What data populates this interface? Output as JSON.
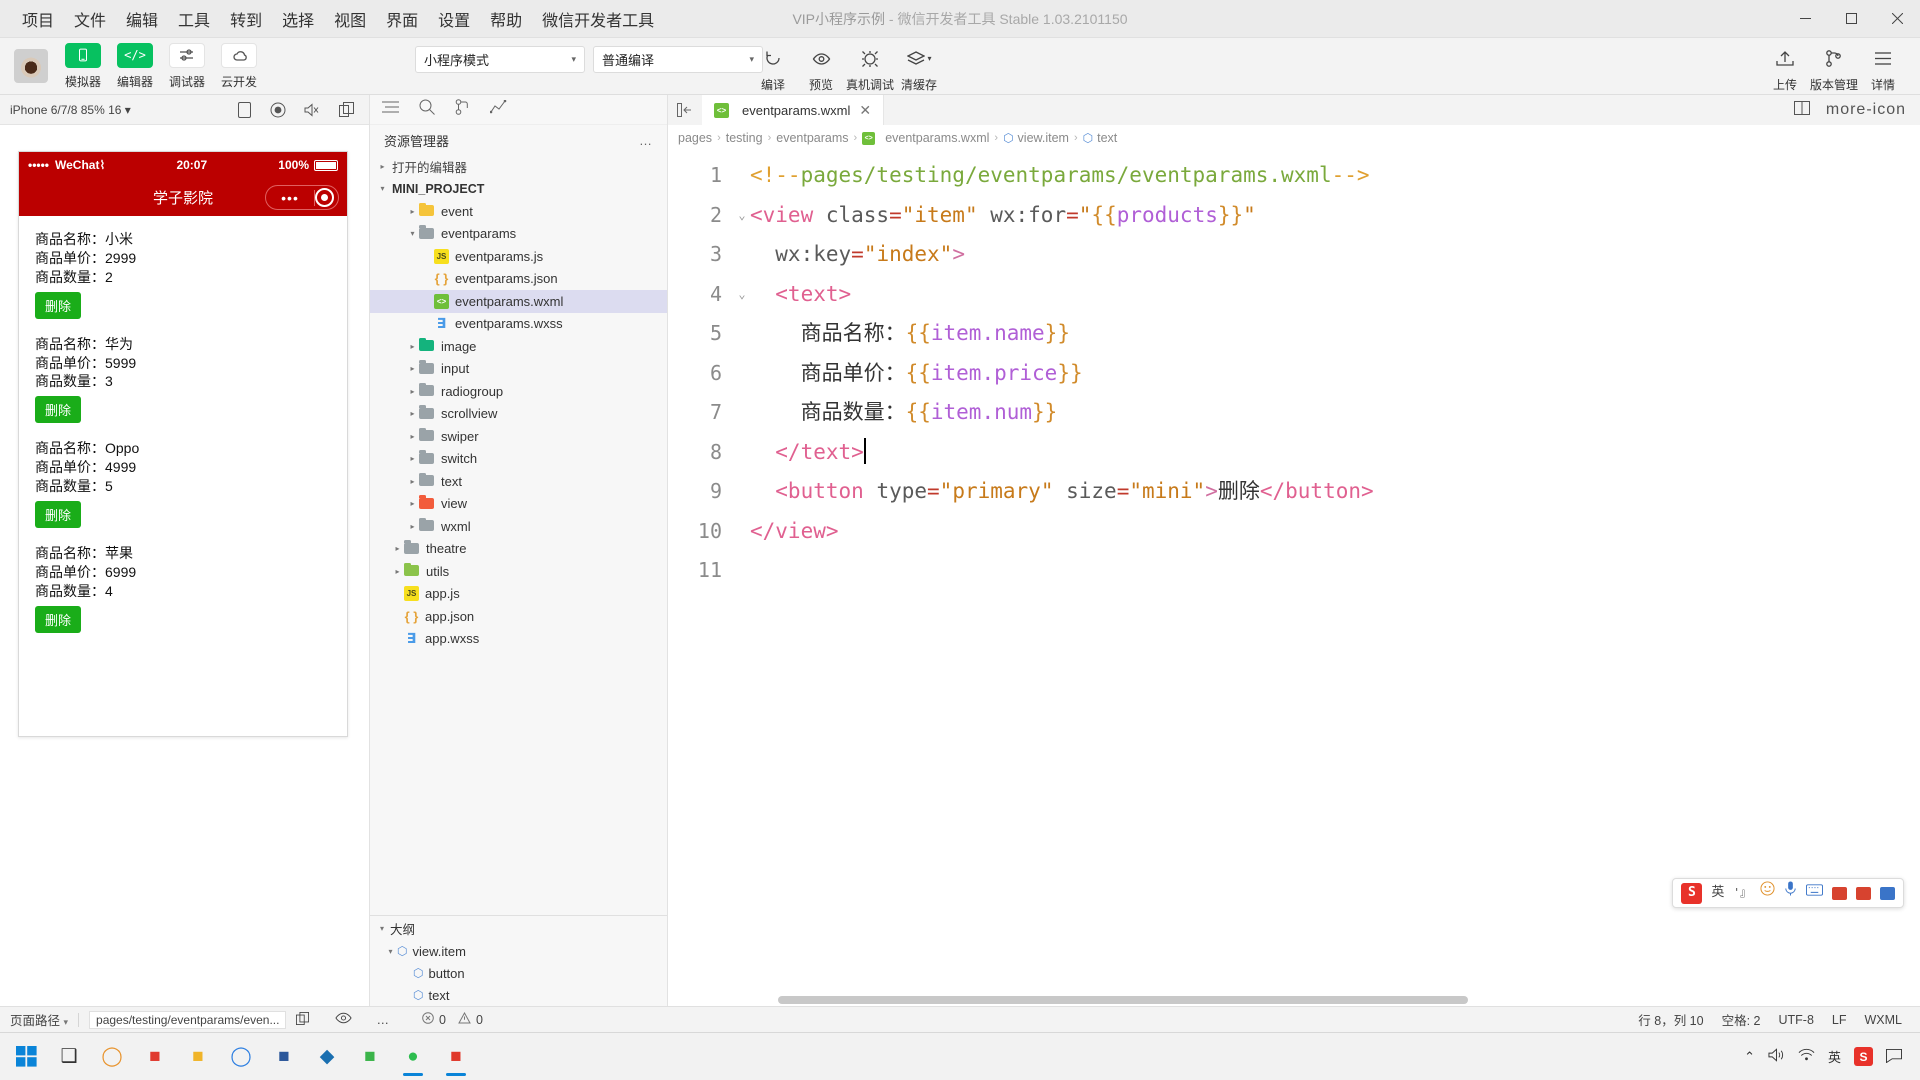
{
  "titlebar": {
    "menu": [
      "项目",
      "文件",
      "编辑",
      "工具",
      "转到",
      "选择",
      "视图",
      "界面",
      "设置",
      "帮助",
      "微信开发者工具"
    ],
    "title_primary": "VIP小程序示例",
    "title_rest": "- 微信开发者工具 Stable 1.03.2101150",
    "minimize": "─",
    "maximize": "☐",
    "close": "✕"
  },
  "toolbar": {
    "left_buttons": [
      {
        "label": "模拟器",
        "icon": "phone-icon",
        "active": true
      },
      {
        "label": "编辑器",
        "icon": "code-icon",
        "active": true
      },
      {
        "label": "调试器",
        "icon": "sliders-icon",
        "active": false
      },
      {
        "label": "云开发",
        "icon": "cloud-icon",
        "active": false
      }
    ],
    "mode_select": {
      "value": "小程序模式",
      "caret": "▾"
    },
    "compile_select": {
      "value": "普通编译",
      "caret": "▾"
    },
    "center_buttons": [
      {
        "label": "编译",
        "icon": "refresh-icon"
      },
      {
        "label": "预览",
        "icon": "eye-icon"
      },
      {
        "label": "真机调试",
        "icon": "device-debug-icon"
      },
      {
        "label": "清缓存",
        "icon": "layers-icon",
        "caret": "▾"
      }
    ],
    "right_buttons": [
      {
        "label": "上传",
        "icon": "upload-icon"
      },
      {
        "label": "版本管理",
        "icon": "branch-icon"
      },
      {
        "label": "详情",
        "icon": "menu-icon"
      }
    ]
  },
  "simulator": {
    "device_label": "iPhone 6/7/8 85% 16",
    "device_caret": "▾",
    "toolbar_icons": [
      "rotate-icon",
      "record-icon",
      "mute-icon",
      "copy-icon"
    ],
    "status": {
      "signal": "•••••",
      "carrier": "WeChat",
      "wifi": "⌇",
      "time": "20:07",
      "battery": "100%"
    },
    "nav_title": "学子影院",
    "capsule_dots": "•••",
    "products": [
      {
        "name_label": "商品名称：",
        "name": "小米",
        "price_label": "商品单价：",
        "price": "2999",
        "num_label": "商品数量：",
        "num": "2",
        "button": "删除"
      },
      {
        "name_label": "商品名称：",
        "name": "华为",
        "price_label": "商品单价：",
        "price": "5999",
        "num_label": "商品数量：",
        "num": "3",
        "button": "删除"
      },
      {
        "name_label": "商品名称：",
        "name": "Oppo",
        "price_label": "商品单价：",
        "price": "4999",
        "num_label": "商品数量：",
        "num": "5",
        "button": "删除"
      },
      {
        "name_label": "商品名称：",
        "name": "苹果",
        "price_label": "商品单价：",
        "price": "6999",
        "num_label": "商品数量：",
        "num": "4",
        "button": "删除"
      }
    ]
  },
  "explorer": {
    "tools": [
      "list-icon",
      "search-icon",
      "source-control-icon",
      "graph-icon"
    ],
    "header": "资源管理器",
    "header_dots": "…",
    "sections": [
      {
        "label": "打开的编辑器",
        "expanded": false
      },
      {
        "label": "MINI_PROJECT",
        "expanded": true
      }
    ],
    "tree": [
      {
        "label": "event",
        "type": "folder",
        "color": "yellow",
        "depth": 2,
        "expanded": false
      },
      {
        "label": "eventparams",
        "type": "folder",
        "color": "grey",
        "depth": 2,
        "expanded": true
      },
      {
        "label": "eventparams.js",
        "type": "js",
        "depth": 3
      },
      {
        "label": "eventparams.json",
        "type": "json",
        "depth": 3
      },
      {
        "label": "eventparams.wxml",
        "type": "wxml",
        "depth": 3,
        "selected": true
      },
      {
        "label": "eventparams.wxss",
        "type": "wxss",
        "depth": 3
      },
      {
        "label": "image",
        "type": "folder",
        "color": "green",
        "depth": 2,
        "expanded": false
      },
      {
        "label": "input",
        "type": "folder",
        "color": "grey",
        "depth": 2,
        "expanded": false
      },
      {
        "label": "radiogroup",
        "type": "folder",
        "color": "grey",
        "depth": 2,
        "expanded": false
      },
      {
        "label": "scrollview",
        "type": "folder",
        "color": "grey",
        "depth": 2,
        "expanded": false
      },
      {
        "label": "swiper",
        "type": "folder",
        "color": "grey",
        "depth": 2,
        "expanded": false
      },
      {
        "label": "switch",
        "type": "folder",
        "color": "grey",
        "depth": 2,
        "expanded": false
      },
      {
        "label": "text",
        "type": "folder",
        "color": "grey",
        "depth": 2,
        "expanded": false
      },
      {
        "label": "view",
        "type": "folder",
        "color": "red",
        "depth": 2,
        "expanded": false
      },
      {
        "label": "wxml",
        "type": "folder",
        "color": "grey",
        "depth": 2,
        "expanded": false
      },
      {
        "label": "theatre",
        "type": "folder",
        "color": "grey",
        "depth": 1,
        "expanded": false
      },
      {
        "label": "utils",
        "type": "folder",
        "color": "lgreen",
        "depth": 1,
        "expanded": false
      },
      {
        "label": "app.js",
        "type": "js",
        "depth": 1
      },
      {
        "label": "app.json",
        "type": "json",
        "depth": 1
      },
      {
        "label": "app.wxss",
        "type": "wxss",
        "depth": 1
      }
    ],
    "outline": {
      "title": "大纲",
      "caret": "▾",
      "items": [
        {
          "label": "view.item",
          "depth": 0,
          "expanded": true
        },
        {
          "label": "button",
          "depth": 1
        },
        {
          "label": "text",
          "depth": 1
        }
      ]
    }
  },
  "editor": {
    "tab": {
      "label": "eventparams.wxml",
      "close": "✕",
      "icon": "wxml-file-icon"
    },
    "actions": [
      "split-editor-icon",
      "more-icon"
    ],
    "breadcrumb": [
      {
        "label": "pages",
        "icon": null
      },
      {
        "label": "testing",
        "icon": null
      },
      {
        "label": "eventparams",
        "icon": null
      },
      {
        "label": "eventparams.wxml",
        "icon": "wxml-file-icon"
      },
      {
        "label": "view.item",
        "icon": "hex-icon"
      },
      {
        "label": "text",
        "icon": "hex-icon"
      }
    ],
    "breadcrumb_sep": "›",
    "lines": [
      {
        "n": "1",
        "fold": "",
        "tokens": [
          {
            "t": "<!--",
            "c": "tk-cmt-b"
          },
          {
            "t": "pages/testing/eventparams/eventparams.wxml",
            "c": "tk-cmt"
          },
          {
            "t": "-->",
            "c": "tk-cmt-b"
          }
        ]
      },
      {
        "n": "2",
        "fold": "⌄",
        "tokens": [
          {
            "t": "<view",
            "c": "tk-tag"
          },
          {
            "t": " class",
            "c": "tk-attr"
          },
          {
            "t": "=",
            "c": "tk-eq"
          },
          {
            "t": "\"item\"",
            "c": "tk-str"
          },
          {
            "t": " wx:for",
            "c": "tk-attr"
          },
          {
            "t": "=",
            "c": "tk-eq"
          },
          {
            "t": "\"",
            "c": "tk-str"
          },
          {
            "t": "{{",
            "c": "tk-brace"
          },
          {
            "t": "products",
            "c": "tk-mus"
          },
          {
            "t": "}}",
            "c": "tk-brace"
          },
          {
            "t": "\"",
            "c": "tk-str"
          }
        ]
      },
      {
        "n": "3",
        "fold": "",
        "tokens": [
          {
            "t": "  wx:key",
            "c": "tk-attr"
          },
          {
            "t": "=",
            "c": "tk-eq"
          },
          {
            "t": "\"index\"",
            "c": "tk-str"
          },
          {
            "t": ">",
            "c": "tk-punct"
          }
        ]
      },
      {
        "n": "4",
        "fold": "⌄",
        "tokens": [
          {
            "t": "  <text>",
            "c": "tk-tag"
          }
        ]
      },
      {
        "n": "5",
        "fold": "",
        "tokens": [
          {
            "t": "    商品名称：",
            "c": "tk-plain"
          },
          {
            "t": "{{",
            "c": "tk-brace"
          },
          {
            "t": "item.name",
            "c": "tk-mus"
          },
          {
            "t": "}}",
            "c": "tk-brace"
          }
        ]
      },
      {
        "n": "6",
        "fold": "",
        "tokens": [
          {
            "t": "    商品单价：",
            "c": "tk-plain"
          },
          {
            "t": "{{",
            "c": "tk-brace"
          },
          {
            "t": "item.price",
            "c": "tk-mus"
          },
          {
            "t": "}}",
            "c": "tk-brace"
          }
        ]
      },
      {
        "n": "7",
        "fold": "",
        "tokens": [
          {
            "t": "    商品数量：",
            "c": "tk-plain"
          },
          {
            "t": "{{",
            "c": "tk-brace"
          },
          {
            "t": "item.num",
            "c": "tk-mus"
          },
          {
            "t": "}}",
            "c": "tk-brace"
          }
        ]
      },
      {
        "n": "8",
        "fold": "",
        "tokens": [
          {
            "t": "  </text>",
            "c": "tk-tag"
          }
        ],
        "cursor": true
      },
      {
        "n": "9",
        "fold": "",
        "tokens": [
          {
            "t": "  <button",
            "c": "tk-tag"
          },
          {
            "t": " type",
            "c": "tk-attr"
          },
          {
            "t": "=",
            "c": "tk-eq"
          },
          {
            "t": "\"primary\"",
            "c": "tk-str"
          },
          {
            "t": " size",
            "c": "tk-attr"
          },
          {
            "t": "=",
            "c": "tk-eq"
          },
          {
            "t": "\"mini\"",
            "c": "tk-str"
          },
          {
            "t": ">",
            "c": "tk-punct"
          },
          {
            "t": "删除",
            "c": "tk-plain"
          },
          {
            "t": "</button>",
            "c": "tk-tag"
          }
        ]
      },
      {
        "n": "10",
        "fold": "",
        "tokens": [
          {
            "t": "</view>",
            "c": "tk-tag"
          }
        ]
      },
      {
        "n": "11",
        "fold": "",
        "tokens": []
      }
    ],
    "ime": {
      "logo": "S",
      "lang": "英",
      "items": [
        "tone-icon",
        "emoji-icon",
        "mic-icon",
        "keyboard-icon",
        "tools-icon",
        "gift-icon",
        "apps-icon"
      ]
    }
  },
  "statusbar": {
    "page_path_label": "页面路径",
    "page_path_caret": "▾",
    "page_path_value": "pages/testing/eventparams/even...",
    "copy_icon": "copy-icon",
    "eye_icon": "eye-icon",
    "more": "…",
    "errors": "0",
    "warnings": "0",
    "cursor": "行 8，列 10",
    "spaces": "空格: 2",
    "encoding": "UTF-8",
    "eol": "LF",
    "language": "WXML"
  },
  "taskbar": {
    "start": "start-icon",
    "items": [
      {
        "name": "task-view-icon",
        "glyph": "❑",
        "color": "#333",
        "running": false
      },
      {
        "name": "cortana-icon",
        "glyph": "◯",
        "color": "#e8922a",
        "running": false
      },
      {
        "name": "notepad-icon",
        "glyph": "■",
        "color": "#e03a2f",
        "running": false
      },
      {
        "name": "file-explorer-icon",
        "glyph": "■",
        "color": "#f0b429",
        "running": false
      },
      {
        "name": "chrome-icon",
        "glyph": "◯",
        "color": "#2a7de1",
        "running": false
      },
      {
        "name": "word-icon",
        "glyph": "■",
        "color": "#2b579a",
        "running": false
      },
      {
        "name": "vscode-icon",
        "glyph": "◆",
        "color": "#1a6fb0",
        "running": false
      },
      {
        "name": "bandizip-icon",
        "glyph": "■",
        "color": "#3bb44a",
        "running": false
      },
      {
        "name": "wechat-devtools-icon",
        "glyph": "●",
        "color": "#2dbd4f",
        "running": true
      },
      {
        "name": "pdf-icon",
        "glyph": "■",
        "color": "#e0392b",
        "running": true
      }
    ],
    "tray": {
      "chevron": "⌃",
      "volume": "volume-icon",
      "network": "network-icon",
      "ime": "英",
      "sogou": "sogou-icon",
      "notification": "notification-icon"
    }
  }
}
